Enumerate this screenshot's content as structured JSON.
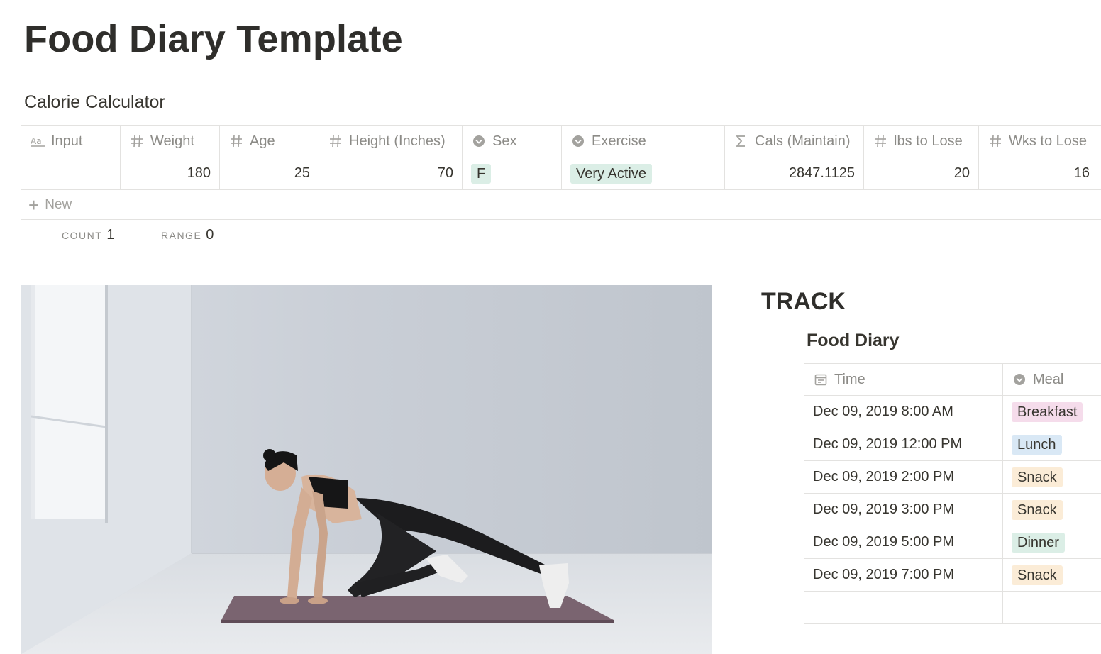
{
  "page": {
    "title": "Food Diary Template"
  },
  "calculator": {
    "title": "Calorie Calculator",
    "columns": [
      {
        "label": "Input",
        "icon": "text-icon"
      },
      {
        "label": "Weight",
        "icon": "hash-icon"
      },
      {
        "label": "Age",
        "icon": "hash-icon"
      },
      {
        "label": "Height (Inches)",
        "icon": "hash-icon"
      },
      {
        "label": "Sex",
        "icon": "select-icon"
      },
      {
        "label": "Exercise",
        "icon": "select-icon"
      },
      {
        "label": "Cals (Maintain)",
        "icon": "sigma-icon"
      },
      {
        "label": "lbs to Lose",
        "icon": "hash-icon"
      },
      {
        "label": "Wks to Lose",
        "icon": "hash-icon"
      }
    ],
    "row": {
      "input": "",
      "weight": "180",
      "age": "25",
      "height": "70",
      "sex": "F",
      "exercise": "Very Active",
      "cals": "2847.1125",
      "lbs": "20",
      "wks": "16"
    },
    "new_label": "New",
    "footer": {
      "count_label": "COUNT",
      "count_value": "1",
      "range_label": "RANGE",
      "range_value": "0"
    },
    "colors": {
      "sex_tag": "#dbeee6",
      "exercise_tag": "#dbeee6"
    }
  },
  "track": {
    "title": "TRACK",
    "diary_title": "Food Diary",
    "columns": [
      {
        "label": "Time",
        "icon": "calendar-icon"
      },
      {
        "label": "Meal",
        "icon": "select-icon"
      }
    ],
    "rows": [
      {
        "time": "Dec 09, 2019 8:00 AM",
        "meal": "Breakfast",
        "color": "#f5dceb"
      },
      {
        "time": "Dec 09, 2019 12:00 PM",
        "meal": "Lunch",
        "color": "#d9e8f5"
      },
      {
        "time": "Dec 09, 2019 2:00 PM",
        "meal": "Snack",
        "color": "#fbecd7"
      },
      {
        "time": "Dec 09, 2019 3:00 PM",
        "meal": "Snack",
        "color": "#fbecd7"
      },
      {
        "time": "Dec 09, 2019 5:00 PM",
        "meal": "Dinner",
        "color": "#dbeee6"
      },
      {
        "time": "Dec 09, 2019 7:00 PM",
        "meal": "Snack",
        "color": "#fbecd7"
      }
    ]
  }
}
